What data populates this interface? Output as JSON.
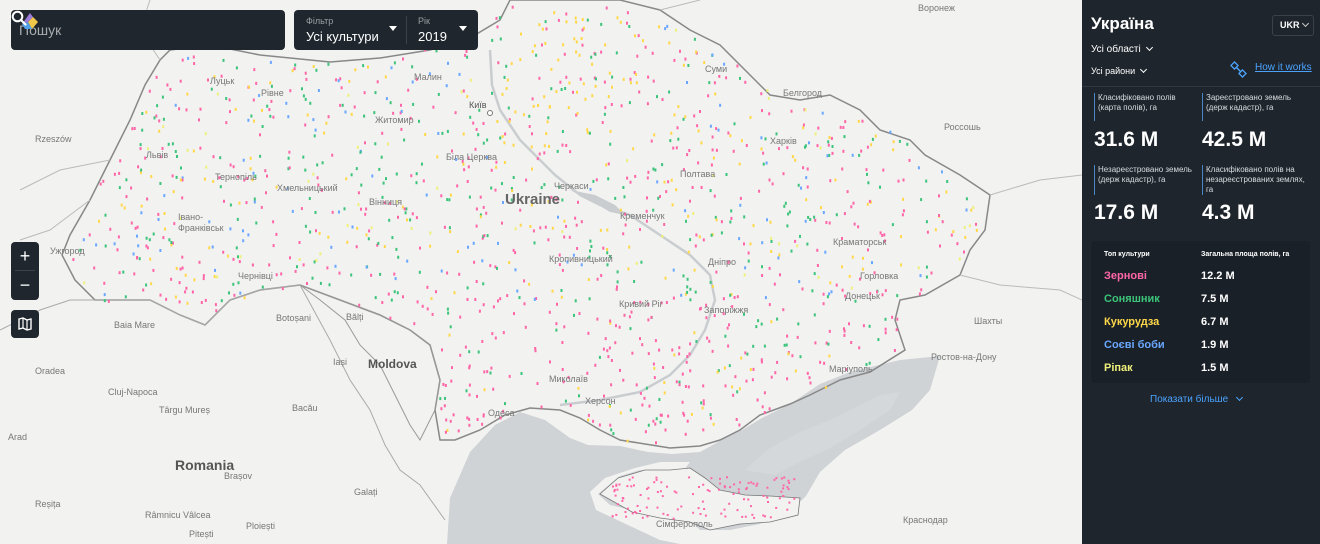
{
  "search": {
    "placeholder": "Пошук"
  },
  "filter": {
    "label": "Фільтр",
    "value": "Усі культури"
  },
  "year": {
    "label": "Рік",
    "value": "2019"
  },
  "zoom": {
    "in_label": "+",
    "out_label": "−"
  },
  "map_labels": {
    "voronezh": "Воронеж",
    "lutsk": "Луцьк",
    "rivne": "Рівне",
    "malyn": "Малин",
    "kyiv": "Київ",
    "zhytomyr": "Житомир",
    "sumy": "Суми",
    "bilhorod": "Белгород",
    "rossosh": "Россошь",
    "rzeszow": "Rzeszów",
    "lviv": "Львів",
    "bila_tserkva": "Біла Церква",
    "kharkiv": "Харків",
    "ternopil": "Тернопіль",
    "khmelnytskyi": "Хмельницький",
    "cherkasy": "Черкаси",
    "poltava": "Полтава",
    "ukraine": "Ukraine",
    "vinnytsia": "Вінниця",
    "kremenchuk": "Кременчук",
    "ivano_frankivsk": "Івано-\nФранківськ",
    "uzhhorod": "Ужгород",
    "kramatorsk": "Краматорськ",
    "chernivtsi": "Чернівці",
    "kropyvnytskyi": "Кропивницький",
    "dnipro": "Дніпро",
    "horlivka": "Горловка",
    "donetsk": "Донецьк",
    "kryvyi_rih": "Кривий Ріг",
    "zaporizhzhia": "Запоріжжя",
    "baia_mare": "Baia Mare",
    "botosani": "Botoșani",
    "balti": "Bălți",
    "shakhty": "Шахты",
    "moldova": "Moldova",
    "iasi": "Iași",
    "rostov": "Ростов-на-Дону",
    "oradea": "Oradea",
    "mykolaiv": "Миколаїв",
    "mariupol": "Маріуполь",
    "cluj": "Cluj-Napoca",
    "targu_mures": "Târgu Mureș",
    "bacau": "Bacău",
    "odesa": "Одеса",
    "kherson": "Херсон",
    "arad": "Arad",
    "romania": "Romania",
    "brasov": "Brașov",
    "galati": "Galați",
    "resita": "Reșița",
    "ramnicu": "Râmnicu Vâlcea",
    "pitesti": "Pitești",
    "ploiesti": "Ploiești",
    "simferopol": "Сімферополь",
    "krasnodar": "Краснодар"
  },
  "panel": {
    "title": "Україна",
    "lang": "UKR",
    "region_select": "Усі області",
    "district_select": "Усі райони",
    "how_it_works": "How it works",
    "stats": [
      {
        "label": "Класифіковано полів (карта полів), га",
        "value": "31.6 M"
      },
      {
        "label": "Зареєстровано земель (держ кадастр), га",
        "value": "42.5 M"
      },
      {
        "label": "Незареєстровано земель (держ кадастр), га",
        "value": "17.6 M"
      },
      {
        "label": "Класифіковано полів на незареєстрованих землях, га",
        "value": "4.3 M"
      }
    ],
    "top_header": "Топ культури",
    "area_header": "Загальна площа полів, га",
    "crops": [
      {
        "name": "Зернові",
        "value": "12.2 M",
        "color": "#ff66a8"
      },
      {
        "name": "Соняшник",
        "value": "7.5 M",
        "color": "#3cc47a"
      },
      {
        "name": "Кукурудза",
        "value": "6.7 M",
        "color": "#ffd84a"
      },
      {
        "name": "Соєві боби",
        "value": "1.9 M",
        "color": "#6aa7ff"
      },
      {
        "name": "Ріпак",
        "value": "1.5 M",
        "color": "#eef07a"
      }
    ],
    "show_more": "Показати більше"
  },
  "colors": {
    "panel_bg": "#1e252c",
    "accent": "#4ba3ff",
    "water": "#cfd3d6",
    "land": "#f2f2f1"
  }
}
